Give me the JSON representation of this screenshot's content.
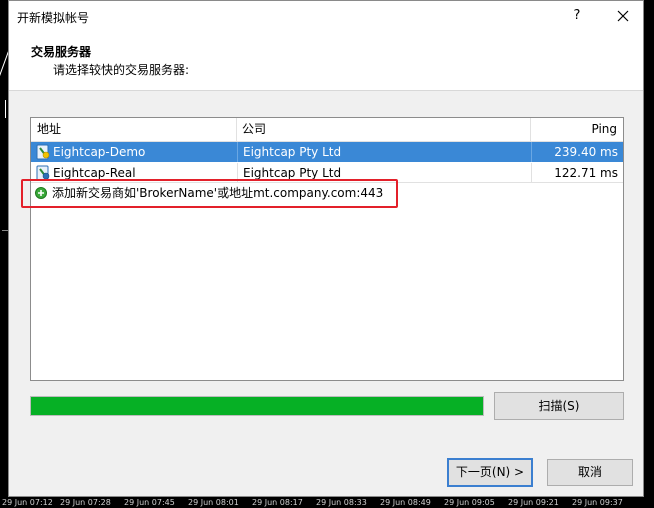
{
  "window": {
    "title": "开新模拟帐号",
    "help_label": "?",
    "close_icon": "close-icon"
  },
  "header": {
    "title": "交易服务器",
    "subtitle": "请选择较快的交易服务器:"
  },
  "server_list": {
    "columns": [
      "地址",
      "公司",
      "Ping"
    ],
    "rows": [
      {
        "address": "Eightcap-Demo",
        "company": "Eightcap Pty Ltd",
        "ping": "239.40 ms",
        "selected": true,
        "icon": "server-icon"
      },
      {
        "address": "Eightcap-Real",
        "company": "Eightcap Pty Ltd",
        "ping": "122.71 ms",
        "selected": false,
        "icon": "server-icon"
      }
    ],
    "add_hint": "添加新交易商如'BrokerName'或地址mt.company.com:443",
    "add_icon": "plus-circle-icon"
  },
  "scan": {
    "progress_percent": 100,
    "button_label": "扫描(S)"
  },
  "footer": {
    "next_label": "下一页(N) >",
    "cancel_label": "取消"
  },
  "background_axis": {
    "labels": [
      "29 Jun 07:12",
      "29 Jun 07:28",
      "29 Jun 07:45",
      "29 Jun 08:01",
      "29 Jun 08:17",
      "29 Jun 08:33",
      "29 Jun 08:49",
      "29 Jun 09:05",
      "29 Jun 09:21",
      "29 Jun 09:37"
    ]
  },
  "colors": {
    "selection": "#3a88d6",
    "progress": "#06b025",
    "highlight_box": "#e3202a"
  }
}
